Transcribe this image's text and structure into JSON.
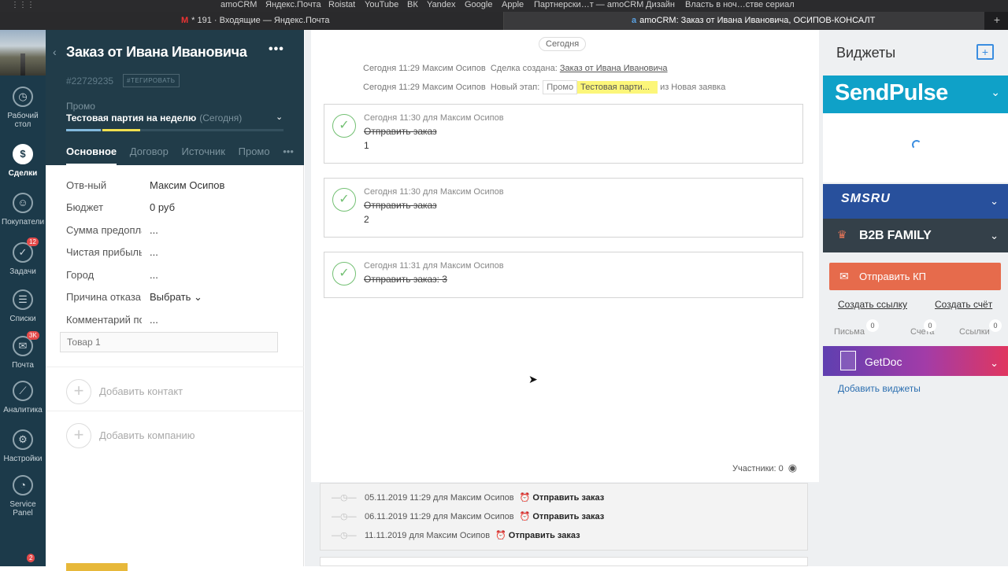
{
  "bookmarks": [
    "amoCRM",
    "Яндекс.Почта",
    "Roistat",
    "YouTube",
    "ВК",
    "Yandex",
    "Google",
    "Apple",
    "Партнерски…т — amoCRM",
    "Дизайн",
    "Власть в ноч…стве сериал"
  ],
  "tabs": [
    {
      "icon": "M",
      "title": "* 191 · Входящие — Яндекс.Почта"
    },
    {
      "icon": "a",
      "title": "amoCRM: Заказ от Ивана Ивановича, ОСИПОВ-КОНСАЛТ"
    }
  ],
  "nav": [
    {
      "label": "Рабочий стол",
      "icon": "◷",
      "badge": ""
    },
    {
      "label": "Сделки",
      "icon": "$",
      "badge": ""
    },
    {
      "label": "Покупатели",
      "icon": "☺",
      "badge": ""
    },
    {
      "label": "Задачи",
      "icon": "✓",
      "badge": "12"
    },
    {
      "label": "Списки",
      "icon": "☰",
      "badge": ""
    },
    {
      "label": "Почта",
      "icon": "✉",
      "badge": "3K"
    },
    {
      "label": "Аналитика",
      "icon": "⟋",
      "badge": ""
    },
    {
      "label": "Настройки",
      "icon": "⚙",
      "badge": ""
    },
    {
      "label": "Service Panel",
      "icon": "◔",
      "badge": ""
    },
    {
      "label": "",
      "icon": "",
      "badge": "2"
    }
  ],
  "deal": {
    "back": "‹",
    "title": "Заказ от Ивана Ивановича",
    "menu": "•••",
    "id": "#22729235",
    "tag_btn": "#ТЕГИРОВАТЬ",
    "pipeline": "Промо",
    "stage": "Тестовая партия на неделю",
    "stage_date": "(Сегодня)",
    "tabs": [
      "Основное",
      "Договор",
      "Источник",
      "Промо",
      "•••"
    ],
    "fields": [
      {
        "label": "Отв-ный",
        "value": "Максим Осипов"
      },
      {
        "label": "Бюджет",
        "value": "0 руб"
      },
      {
        "label": "Сумма предоплаты",
        "value": "..."
      },
      {
        "label": "Чистая прибыль",
        "value": "..."
      },
      {
        "label": "Город",
        "value": "..."
      },
      {
        "label": "Причина отказа",
        "value": "Выбрать ⌄"
      },
      {
        "label": "Комментарий по заказу",
        "value": "..."
      }
    ],
    "product": "Товар 1",
    "add_contact": "Добавить контакт",
    "add_company": "Добавить компанию"
  },
  "feed": {
    "today": "Сегодня",
    "events": [
      {
        "when": "Сегодня 11:29 Максим Осипов",
        "text": "Сделка создана:",
        "link": "Заказ от Ивана Ивановича"
      },
      {
        "when": "Сегодня 11:29 Максим Осипов",
        "text": "Новый этап:",
        "promo": "Промо",
        "stage": "Тестовая парти...",
        "tail": "из Новая заявка"
      }
    ],
    "tasks": [
      {
        "meta": "Сегодня 11:30  для Максим Осипов",
        "name": "Отправить заказ",
        "result": "1"
      },
      {
        "meta": "Сегодня 11:30  для Максим Осипов",
        "name": "Отправить заказ",
        "result": "2"
      },
      {
        "meta": "Сегодня 11:31  для Максим Осипов",
        "name": "Отправить заказ: 3",
        "result": ""
      }
    ],
    "participants": "Участники: 0",
    "scheduled": [
      {
        "when": "05.11.2019 11:29 для Максим Осипов",
        "task": "Отправить заказ"
      },
      {
        "when": "06.11.2019 11:29 для Максим Осипов",
        "task": "Отправить заказ"
      },
      {
        "when": "11.11.2019 для Максим Осипов",
        "task": "Отправить заказ"
      }
    ]
  },
  "widgets": {
    "title": "Виджеты",
    "sendpulse": "SendPulse",
    "smsru": "SMSRU",
    "b2b": "B2B FAMILY",
    "send_kp": "Отправить КП",
    "create_link": "Создать ссылку",
    "create_invoice": "Создать счёт",
    "counters": [
      {
        "label": "Письма",
        "n": "0"
      },
      {
        "label": "Счета",
        "n": "0"
      },
      {
        "label": "Ссылки",
        "n": "0"
      }
    ],
    "getdoc": "GetDoc",
    "add_widgets": "Добавить виджеты"
  },
  "colors": {
    "sidebar": "#1c3a4a",
    "deal_head": "#213c49",
    "sendpulse": "#0fa1c8",
    "smsru": "#28509c",
    "b2b": "#344049",
    "kp": "#e66b4c"
  }
}
